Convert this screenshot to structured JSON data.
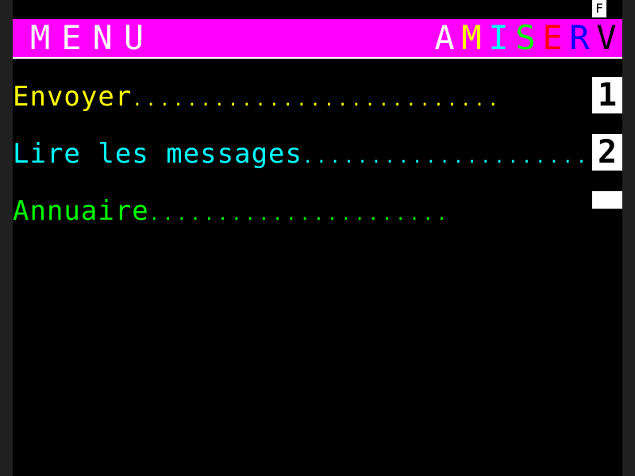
{
  "status": {
    "indicator": "F"
  },
  "header": {
    "title": "MENU",
    "brand_letters": [
      {
        "char": "A",
        "color": "#ffffff"
      },
      {
        "char": "M",
        "color": "#ffff00"
      },
      {
        "char": "I",
        "color": "#00ffff"
      },
      {
        "char": "S",
        "color": "#00ff00"
      },
      {
        "char": "E",
        "color": "#ff0000"
      },
      {
        "char": "R",
        "color": "#0000ff"
      },
      {
        "char": "V",
        "color": "#000000"
      }
    ],
    "bar_color": "#ff00ff"
  },
  "menu": {
    "items": [
      {
        "label": "Envoyer",
        "dots": "...........................",
        "color": "#ffff00",
        "key": "1"
      },
      {
        "label": "Lire les messages",
        "dots": ".....................",
        "color": "#00ffff",
        "key": "2"
      },
      {
        "label": "Annuaire",
        "dots": "......................",
        "color": "#00ff00",
        "key": ""
      }
    ]
  }
}
